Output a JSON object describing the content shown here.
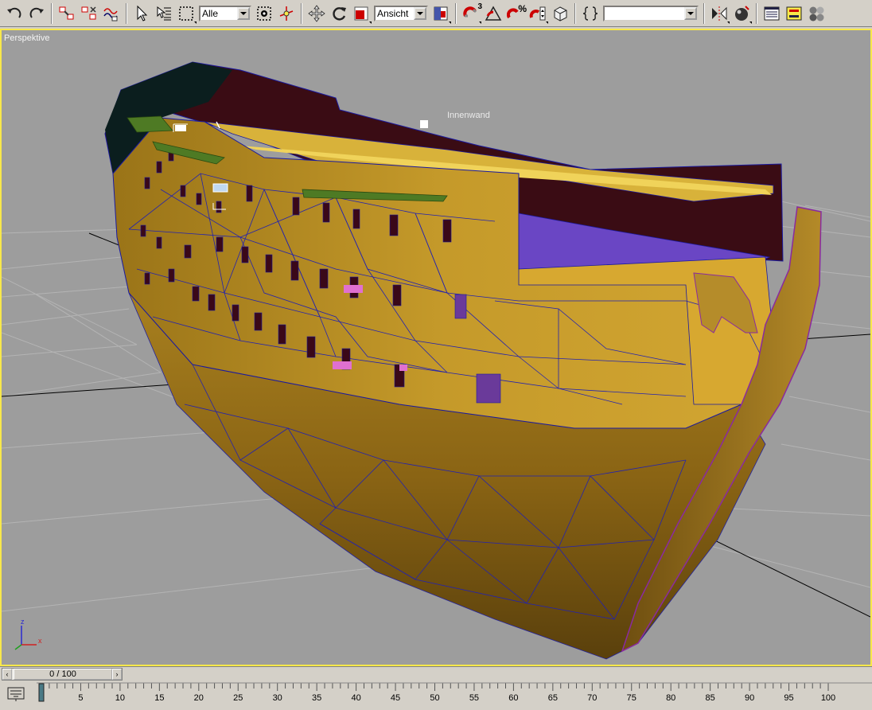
{
  "toolbar": {
    "selection_filter": "Alle",
    "reference_coord": "Ansicht",
    "angle_snap_label": "3",
    "percent_snap_label": "%",
    "named_selection_value": ""
  },
  "viewport": {
    "label": "Perspektive",
    "object_label": "Innenwand",
    "axis_x": "x",
    "axis_z": "z",
    "border_color": "#f8e84a"
  },
  "timeline": {
    "slider_text": "0 / 100",
    "current_frame": 0,
    "total_frames": 100,
    "ruler_labels": [
      "5",
      "10",
      "15",
      "20",
      "25",
      "30",
      "35",
      "40",
      "45",
      "50",
      "55",
      "60",
      "65",
      "70",
      "75",
      "80",
      "85",
      "90",
      "95",
      "100"
    ]
  }
}
